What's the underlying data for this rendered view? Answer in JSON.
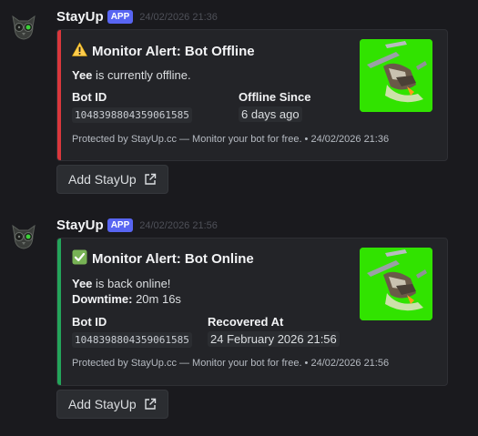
{
  "messages": [
    {
      "username": "StayUp",
      "badge": "APP",
      "timestamp": "24/02/2026 21:36",
      "accent_color": "#da373c",
      "title_emoji": "warning-icon",
      "title": "Monitor Alert: Bot Offline",
      "desc_bold": "Yee",
      "desc_text": " is currently offline.",
      "fields": [
        {
          "name": "Bot ID",
          "value": "1048398804359061585"
        },
        {
          "name": "Offline Since",
          "value": "6 days ago"
        }
      ],
      "footer": "Protected by StayUp.cc — Monitor your bot for free. • 24/02/2026 21:36",
      "button_label": "Add StayUp"
    },
    {
      "username": "StayUp",
      "badge": "APP",
      "timestamp": "24/02/2026 21:56",
      "accent_color": "#23a55a",
      "title_emoji": "check-icon",
      "title": "Monitor Alert: Bot Online",
      "desc_bold": "Yee",
      "desc_text": " is back online!",
      "downtime_label": "Downtime:",
      "downtime_value": " 20m 16s",
      "fields": [
        {
          "name": "Bot ID",
          "value": "1048398804359061585"
        },
        {
          "name": "Recovered At",
          "value": "24 February 2026 21:56"
        }
      ],
      "footer": "Protected by StayUp.cc — Monitor your bot for free. • 24/02/2026 21:56",
      "button_label": "Add StayUp"
    }
  ]
}
